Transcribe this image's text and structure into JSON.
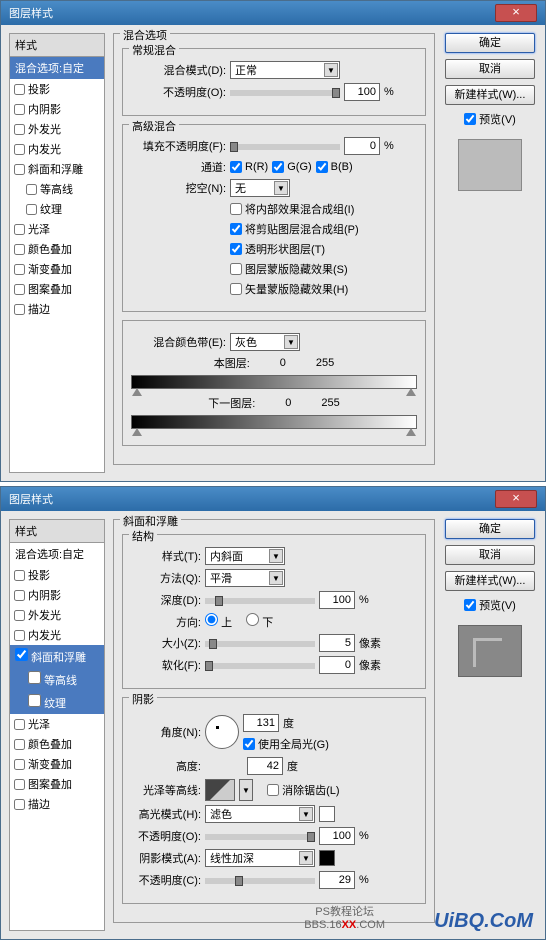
{
  "dialog1": {
    "title": "图层样式",
    "sidebar": {
      "hdr": "样式",
      "sub": "混合选项:自定",
      "items": [
        {
          "label": "投影",
          "chk": false
        },
        {
          "label": "内阴影",
          "chk": false
        },
        {
          "label": "外发光",
          "chk": false
        },
        {
          "label": "内发光",
          "chk": false
        },
        {
          "label": "斜面和浮雕",
          "chk": false
        },
        {
          "label": "等高线",
          "chk": false,
          "indent": true
        },
        {
          "label": "纹理",
          "chk": false,
          "indent": true
        },
        {
          "label": "光泽",
          "chk": false
        },
        {
          "label": "颜色叠加",
          "chk": false
        },
        {
          "label": "渐变叠加",
          "chk": false
        },
        {
          "label": "图案叠加",
          "chk": false
        },
        {
          "label": "描边",
          "chk": false
        }
      ]
    },
    "blend": {
      "title": "混合选项",
      "general": {
        "title": "常规混合",
        "mode_lbl": "混合模式(D):",
        "mode_val": "正常",
        "opacity_lbl": "不透明度(O):",
        "opacity_val": "100",
        "pct": "%"
      },
      "advanced": {
        "title": "高级混合",
        "fill_lbl": "填充不透明度(F):",
        "fill_val": "0",
        "pct": "%",
        "channel_lbl": "通道:",
        "ch_r": "R(R)",
        "ch_g": "G(G)",
        "ch_b": "B(B)",
        "knockout_lbl": "挖空(N):",
        "knockout_val": "无",
        "opt1": "将内部效果混合成组(I)",
        "opt2": "将剪贴图层混合成组(P)",
        "opt3": "透明形状图层(T)",
        "opt4": "图层蒙版隐藏效果(S)",
        "opt5": "矢量蒙版隐藏效果(H)"
      },
      "blendif": {
        "lbl": "混合颜色带(E):",
        "val": "灰色",
        "this_lbl": "本图层:",
        "this_lo": "0",
        "this_hi": "255",
        "under_lbl": "下一图层:",
        "under_lo": "0",
        "under_hi": "255"
      }
    },
    "buttons": {
      "ok": "确定",
      "cancel": "取消",
      "new": "新建样式(W)...",
      "preview": "预览(V)"
    }
  },
  "dialog2": {
    "title": "图层样式",
    "sidebar": {
      "hdr": "样式",
      "sub": "混合选项:自定",
      "items": [
        {
          "label": "投影",
          "chk": false
        },
        {
          "label": "内阴影",
          "chk": false
        },
        {
          "label": "外发光",
          "chk": false
        },
        {
          "label": "内发光",
          "chk": false
        }
      ],
      "active": "斜面和浮雕",
      "subitems": [
        {
          "label": "等高线"
        },
        {
          "label": "纹理"
        }
      ],
      "rest": [
        {
          "label": "光泽",
          "chk": false
        },
        {
          "label": "颜色叠加",
          "chk": false
        },
        {
          "label": "渐变叠加",
          "chk": false
        },
        {
          "label": "图案叠加",
          "chk": false
        },
        {
          "label": "描边",
          "chk": false
        }
      ]
    },
    "bevel": {
      "title": "斜面和浮雕",
      "struct": {
        "title": "结构",
        "style_lbl": "样式(T):",
        "style_val": "内斜面",
        "tech_lbl": "方法(Q):",
        "tech_val": "平滑",
        "depth_lbl": "深度(D):",
        "depth_val": "100",
        "pct": "%",
        "dir_lbl": "方向:",
        "dir_up": "上",
        "dir_down": "下",
        "size_lbl": "大小(Z):",
        "size_val": "5",
        "size_u": "像素",
        "soften_lbl": "软化(F):",
        "soften_val": "0",
        "soften_u": "像素"
      },
      "shade": {
        "title": "阴影",
        "angle_lbl": "角度(N):",
        "angle_val": "131",
        "angle_u": "度",
        "global": "使用全局光(G)",
        "alt_lbl": "高度:",
        "alt_val": "42",
        "alt_u": "度",
        "contour_lbl": "光泽等高线:",
        "aa": "消除锯齿(L)",
        "hi_mode_lbl": "高光模式(H):",
        "hi_mode_val": "滤色",
        "hi_op_lbl": "不透明度(O):",
        "hi_op_val": "100",
        "pct": "%",
        "sh_mode_lbl": "阴影模式(A):",
        "sh_mode_val": "线性加深",
        "sh_op_lbl": "不透明度(C):",
        "sh_op_val": "29"
      }
    },
    "buttons": {
      "ok": "确定",
      "cancel": "取消",
      "new": "新建样式(W)...",
      "preview": "预览(V)"
    }
  },
  "watermark": {
    "brand": "UiBQ.CoM",
    "line1": "PS教程论坛",
    "line2a": "BBS.16",
    "line2b": "XX",
    "line2c": ".COM"
  }
}
